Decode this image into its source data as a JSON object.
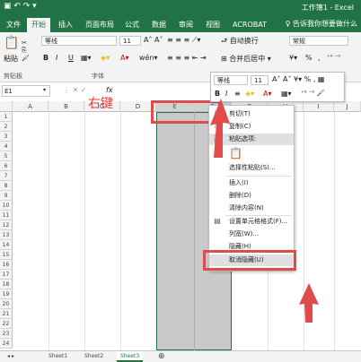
{
  "window": {
    "title": "工作簿1 - Excel"
  },
  "tabs": [
    "文件",
    "开始",
    "插入",
    "页面布局",
    "公式",
    "数据",
    "审阅",
    "视图",
    "ACROBAT"
  ],
  "active_tab": "开始",
  "help_text": "告诉我你想要做什么",
  "ribbon": {
    "paste": "粘贴",
    "clipboard": "剪贴板",
    "font_name": "等线",
    "font_size": "11",
    "font_group": "字体",
    "bold": "B",
    "italic": "I",
    "underline": "U",
    "wrap": "自动换行",
    "merge": "合并后居中",
    "number_format": "常规",
    "percent": "%",
    "comma": ","
  },
  "formula_bar": {
    "name_box": "E1",
    "fx": "fx"
  },
  "annotation": "右键",
  "mini_toolbar": {
    "font": "等线",
    "size": "11",
    "bold": "B",
    "italic": "I"
  },
  "columns": [
    "A",
    "B",
    "C",
    "D",
    "E",
    "F",
    "G",
    "H",
    "I",
    "J",
    "K"
  ],
  "rows": [
    "1",
    "2",
    "3",
    "4",
    "5",
    "6",
    "7",
    "8",
    "9",
    "10",
    "11",
    "12",
    "13",
    "14",
    "15",
    "16",
    "17",
    "18",
    "19",
    "20",
    "21",
    "22",
    "23",
    "24"
  ],
  "context_menu": {
    "cut": "剪切(T)",
    "copy": "复制(C)",
    "paste_options": "粘贴选项:",
    "paste_special": "选择性粘贴(S)...",
    "insert": "插入(I)",
    "delete": "删除(D)",
    "clear": "清除内容(N)",
    "format_cells": "设置单元格格式(F)...",
    "column_width": "列宽(W)...",
    "hide": "隐藏(H)",
    "unhide": "取消隐藏(U)"
  },
  "sheets": [
    "Sheet1",
    "Sheet2",
    "Sheet3"
  ],
  "colors": {
    "excel_green": "#217346",
    "highlight_red": "#e04b4b"
  }
}
